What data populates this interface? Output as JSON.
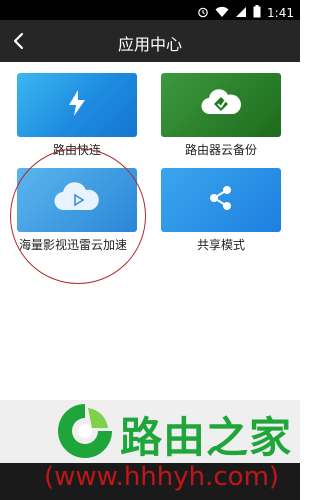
{
  "status_bar": {
    "time": "1:41"
  },
  "header": {
    "title": "应用中心"
  },
  "apps": [
    {
      "label": "路由快连",
      "icon": "lightning-icon"
    },
    {
      "label": "路由器云备份",
      "icon": "cloud-backup-icon"
    },
    {
      "label": "海量影视迅雷云加速",
      "icon": "cloud-play-icon"
    },
    {
      "label": "共享模式",
      "icon": "share-icon"
    }
  ],
  "watermark": {
    "title": "路由之家",
    "url": "(www.hhhyh.com)"
  },
  "colors": {
    "header_bg": "#262626",
    "brand_green": "#1ea63a",
    "watermark_red": "#c0161a"
  }
}
